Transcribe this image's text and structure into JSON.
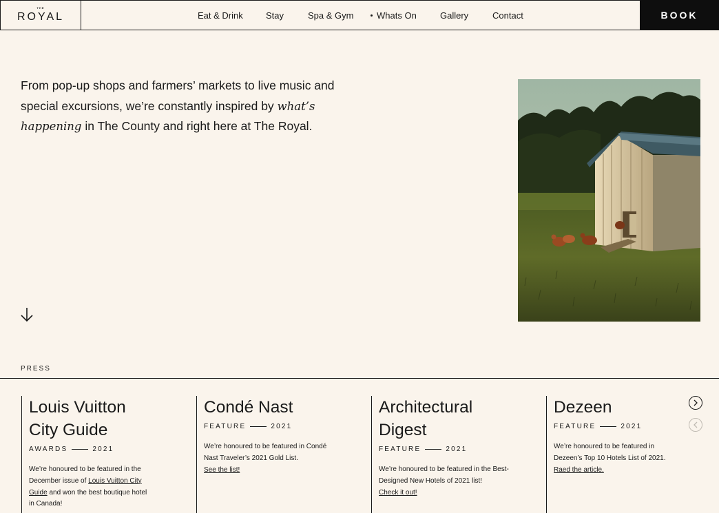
{
  "header": {
    "logo_small": "THE",
    "logo_main": "ROYAL",
    "nav": [
      {
        "label": "Eat & Drink"
      },
      {
        "label": "Stay"
      },
      {
        "label": "Spa & Gym"
      },
      {
        "label": "Whats On"
      },
      {
        "label": "Gallery"
      },
      {
        "label": "Contact"
      }
    ],
    "book_label": "BOOK"
  },
  "intro": {
    "part1": "From pop-up shops and farmers’ markets to live music and special excursions, we’re constantly inspired by ",
    "emphasis": "what’s happening",
    "part2": " in The County and right here at The Royal."
  },
  "photo": {
    "icon": "chicken-coop-photo"
  },
  "press": {
    "label": "PRESS",
    "cards": [
      {
        "title": "Louis Vuitton\nCity Guide",
        "category": "AWARDS",
        "year": "2021",
        "text_before": "We’re honoured to be featured in the December issue of ",
        "link": "Louis Vuitton City Guide",
        "text_after": " and won the best boutique hotel in Canada!"
      },
      {
        "title": "Condé Nast",
        "category": "FEATURE",
        "year": "2021",
        "text_before": "We’re honoured to be featured in Condé Nast Traveler’s 2021 Gold List.",
        "link": "See the list!",
        "text_after": ""
      },
      {
        "title": "Architectural\nDigest",
        "category": "FEATURE",
        "year": "2021",
        "text_before": "We’re honoured to be featured in the Best-Designed New Hotels of 2021 list!",
        "link": "Check it out!",
        "text_after": ""
      },
      {
        "title": "Dezeen",
        "category": "FEATURE",
        "year": "2021",
        "text_before": "We’re honoured to be featured in Dezeen’s Top 10 Hotels List of 2021.",
        "link": "Raed the article.",
        "text_after": ""
      }
    ]
  },
  "colors": {
    "background": "#faf4ec",
    "text": "#1a1a1a",
    "book_bg": "#0e0e0e"
  }
}
